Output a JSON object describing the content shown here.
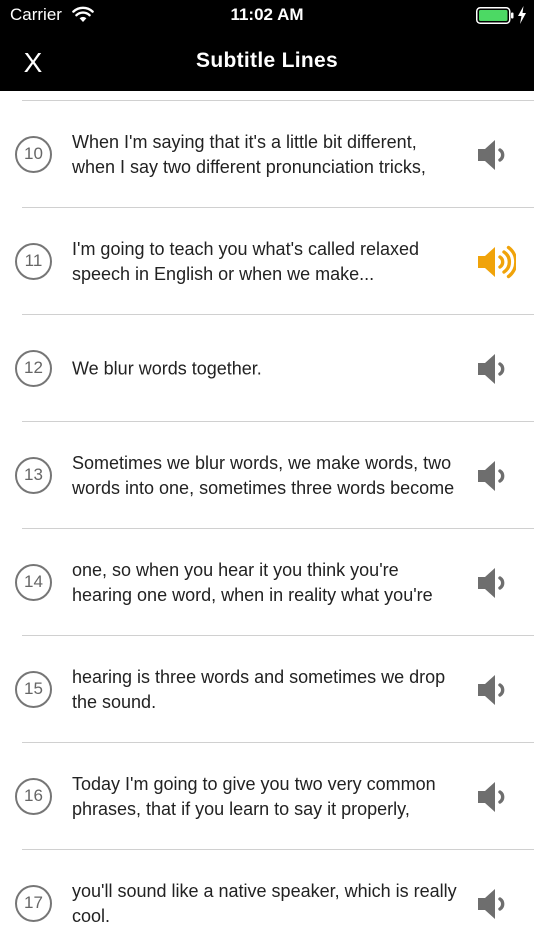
{
  "status_bar": {
    "carrier": "Carrier",
    "time": "11:02 AM",
    "battery_color": "#4cd964"
  },
  "nav": {
    "close_label": "X",
    "title": "Subtitle Lines"
  },
  "colors": {
    "active_speaker": "#f0a30a",
    "inactive_speaker": "#6e6e6e"
  },
  "lines": [
    {
      "number": "10",
      "text": "When I'm saying that it's a little bit different, when I say two different pronunciation tricks,",
      "active": false
    },
    {
      "number": "11",
      "text": "I'm going to teach you what's called relaxed speech in English or when we make...",
      "active": true
    },
    {
      "number": "12",
      "text": "We blur words together.",
      "active": false
    },
    {
      "number": "13",
      "text": "Sometimes we blur words, we make words, two words into one, sometimes three words become",
      "active": false
    },
    {
      "number": "14",
      "text": "one, so when you hear it you think you're hearing one word, when in reality what you're",
      "active": false
    },
    {
      "number": "15",
      "text": "hearing is three words and sometimes we drop the sound.",
      "active": false
    },
    {
      "number": "16",
      "text": "Today I'm going to give you two very common phrases, that if you learn to say it properly,",
      "active": false
    },
    {
      "number": "17",
      "text": "you'll sound like a native speaker, which is really cool.",
      "active": false
    }
  ]
}
